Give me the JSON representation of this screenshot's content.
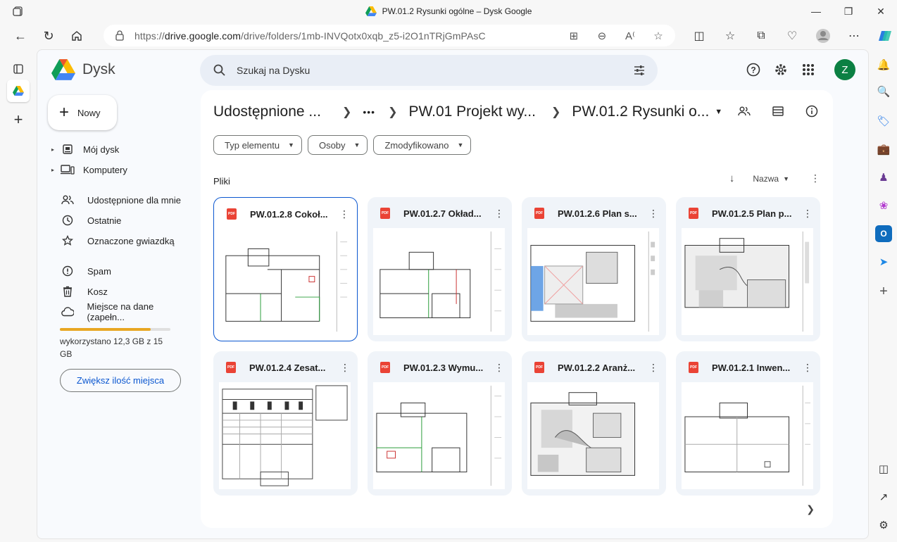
{
  "browser": {
    "window_title": "PW.01.2 Rysunki ogólne – Dysk Google",
    "url_prefix": "https://",
    "url_host": "drive.google.com",
    "url_path": "/drive/folders/1mb-INVQotx0xqb_z5-i2O1nTRjGmPAsC"
  },
  "app": {
    "name": "Dysk",
    "avatar_letter": "Z",
    "search_placeholder": "Szukaj na Dysku"
  },
  "sidebar": {
    "new_label": "Nowy",
    "items": [
      {
        "label": "Mój dysk"
      },
      {
        "label": "Komputery"
      },
      {
        "label": "Udostępnione dla mnie"
      },
      {
        "label": "Ostatnie"
      },
      {
        "label": "Oznaczone gwiazdką"
      },
      {
        "label": "Spam"
      },
      {
        "label": "Kosz"
      },
      {
        "label": "Miejsce na dane (zapełn..."
      }
    ],
    "storage_fraction": 0.82,
    "storage_text": "wykorzystano 12,3 GB z 15 GB",
    "upgrade_label": "Zwiększ ilość miejsca"
  },
  "breadcrumb": {
    "root": "Udostępnione ...",
    "ellipsis": "•••",
    "parent": "PW.01 Projekt wy...",
    "current": "PW.01.2 Rysunki o..."
  },
  "filters": {
    "type": "Typ elementu",
    "people": "Osoby",
    "modified": "Zmodyfikowano"
  },
  "files": {
    "section_label": "Pliki",
    "sort_label": "Nazwa",
    "file_type_badge": "PDF",
    "items": [
      {
        "name": "PW.01.2.8 Cokoł..."
      },
      {
        "name": "PW.01.2.7 Okład..."
      },
      {
        "name": "PW.01.2.6 Plan s..."
      },
      {
        "name": "PW.01.2.5 Plan p..."
      },
      {
        "name": "PW.01.2.4 Zesat..."
      },
      {
        "name": "PW.01.2.3 Wymu..."
      },
      {
        "name": "PW.01.2.2 Aranż..."
      },
      {
        "name": "PW.01.2.1 Inwen..."
      }
    ]
  },
  "colors": {
    "accent": "#0b57d0",
    "storage": "#e8a723",
    "pdf": "#ea4335",
    "avatar": "#0b8043"
  }
}
